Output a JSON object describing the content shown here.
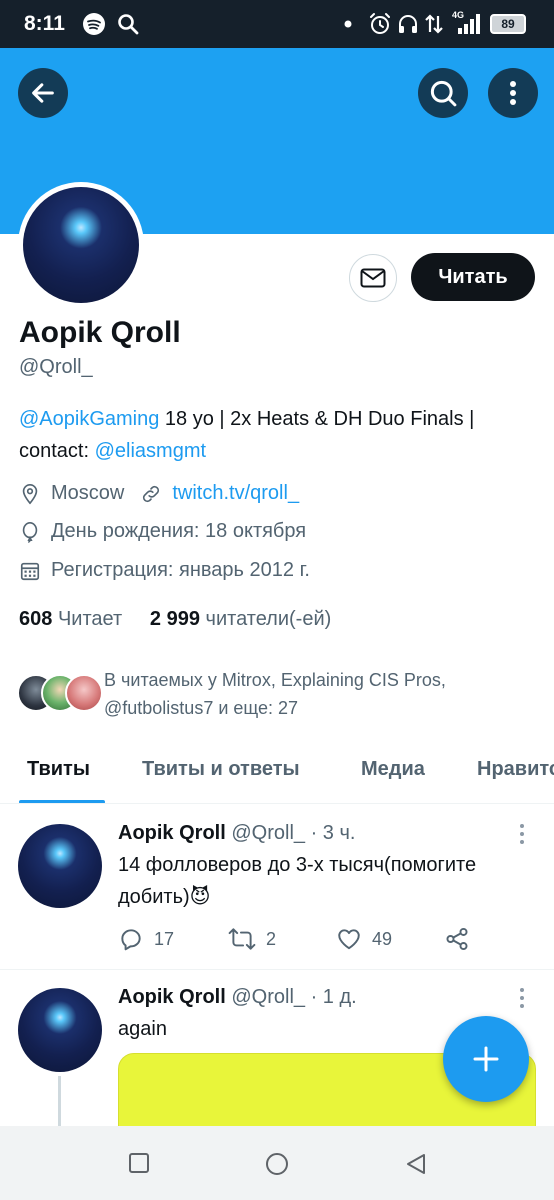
{
  "status_bar": {
    "time": "8:11",
    "network": "4G",
    "battery": "89"
  },
  "header": {
    "back_icon": "arrow-left-icon",
    "search_icon": "search-icon",
    "more_icon": "more-vertical-icon",
    "banner_color": "#1da1f2"
  },
  "profile": {
    "name": "Aopik Qroll",
    "handle": "@Qroll_",
    "follow_label": "Читать",
    "bio_mention_1": "@AopikGaming",
    "bio_text_1": " 18 yo | 2x Heats & DH Duo Finals | contact: ",
    "bio_mention_2": "@eliasmgmt",
    "location": "Moscow",
    "website": "twitch.tv/qroll_",
    "birthday": "День рождения: 18 октября",
    "joined": "Регистрация: январь 2012 г.",
    "following_count": "608",
    "following_label": "Читает",
    "followers_count": "2 999",
    "followers_label": "читатели(-ей)",
    "followed_by": "В читаемых у Mitrox, Explaining CIS Pros, @futbolistus7 и еще: 27"
  },
  "tabs": [
    "Твиты",
    "Твиты и ответы",
    "Медиа",
    "Нравится"
  ],
  "tweets": [
    {
      "name": "Aopik Qroll",
      "handle_time": "@Qroll_ · 3 ч.",
      "text": "14 фолловеров до 3-х тысяч(помогите добить)😈",
      "replies": "17",
      "retweets": "2",
      "likes": "49"
    },
    {
      "name": "Aopik Qroll",
      "handle_time": "@Qroll_ · 1 д.",
      "text": "again"
    }
  ],
  "colors": {
    "accent": "#1d9bf0",
    "text": "#0f1419",
    "muted": "#536471"
  }
}
